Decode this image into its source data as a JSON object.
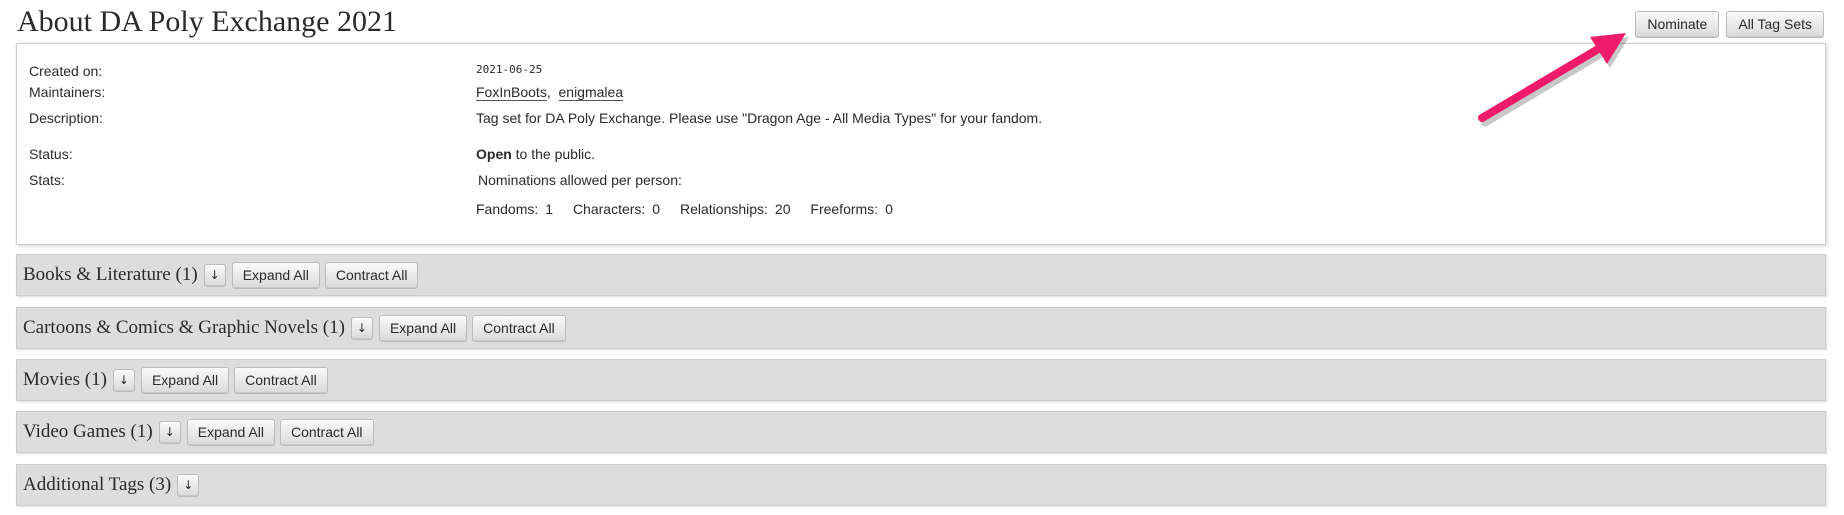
{
  "page": {
    "title": "About DA Poly Exchange 2021"
  },
  "actions": {
    "nominate": "Nominate",
    "all_tag_sets": "All Tag Sets"
  },
  "meta": {
    "created_label": "Created on:",
    "created_value": "2021-06-25",
    "maintainers_label": "Maintainers:",
    "maintainers": [
      "FoxInBoots",
      "enigmalea"
    ],
    "maintainer_sep": ",",
    "description_label": "Description:",
    "description_value": "Tag set for DA Poly Exchange. Please use \"Dragon Age - All Media Types\" for your fandom.",
    "status_label": "Status:",
    "status_bold": "Open",
    "status_rest": " to the public.",
    "stats_label": "Stats:",
    "nominations_text": "Nominations allowed per person:",
    "stats": [
      {
        "label": "Fandoms:",
        "value": "1"
      },
      {
        "label": "Characters:",
        "value": "0"
      },
      {
        "label": "Relationships:",
        "value": "20"
      },
      {
        "label": "Freeforms:",
        "value": "0"
      }
    ]
  },
  "sections": [
    {
      "title": "Books & Literature (1)",
      "toggle": "↓",
      "expand": "Expand All",
      "contract": "Contract All"
    },
    {
      "title": "Cartoons & Comics & Graphic Novels (1)",
      "toggle": "↓",
      "expand": "Expand All",
      "contract": "Contract All"
    },
    {
      "title": "Movies (1)",
      "toggle": "↓",
      "expand": "Expand All",
      "contract": "Contract All"
    },
    {
      "title": "Video Games (1)",
      "toggle": "↓",
      "expand": "Expand All",
      "contract": "Contract All"
    },
    {
      "title": "Additional Tags (3)",
      "toggle": "↓"
    }
  ],
  "colors": {
    "arrow": "#ef1a6c",
    "section_bg": "#dddddd"
  }
}
